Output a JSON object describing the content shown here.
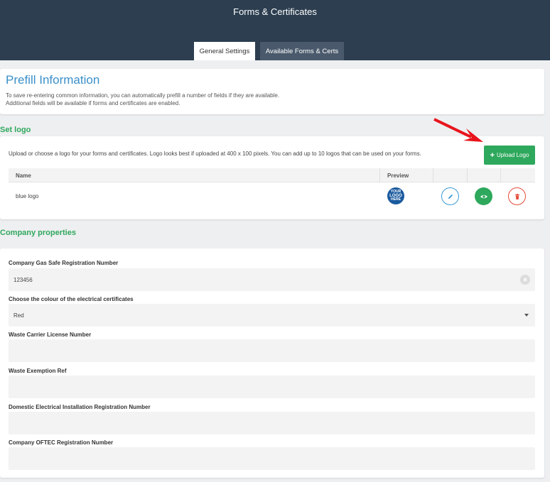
{
  "header": {
    "title": "Forms & Certificates",
    "tabs": [
      {
        "label": "General Settings",
        "active": true
      },
      {
        "label": "Available Forms & Certs",
        "active": false
      }
    ]
  },
  "prefill": {
    "title": "Prefill Information",
    "desc_line1": "To save re-entering common information, you can automatically prefill a number of fields if they are available.",
    "desc_line2": "Additional fields will be available if forms and certificates are enabled."
  },
  "set_logo": {
    "heading": "Set logo",
    "description": "Upload or choose a logo for your forms and certificates. Logo looks best if uploaded at 400 x 100 pixels. You can add up to 10 logos that can be used on your forms.",
    "upload_label": "Upload Logo",
    "columns": {
      "name": "Name",
      "preview": "Preview"
    },
    "rows": [
      {
        "name": "blue logo",
        "preview_text": [
          "YOUR",
          "LOGO",
          "HERE"
        ]
      }
    ]
  },
  "company": {
    "heading": "Company properties",
    "fields": [
      {
        "label": "Company Gas Safe Registration Number",
        "value": "123456",
        "type": "text-clearable"
      },
      {
        "label": "Choose the colour of the electrical certificates",
        "value": "Red",
        "type": "select"
      },
      {
        "label": "Waste Carrier License Number",
        "value": "",
        "type": "text"
      },
      {
        "label": "Waste Exemption Ref",
        "value": "",
        "type": "text"
      },
      {
        "label": "Domestic Electrical Installation Registration Number",
        "value": "",
        "type": "text"
      },
      {
        "label": "Company OFTEC Registration Number",
        "value": "",
        "type": "text"
      }
    ]
  },
  "colors": {
    "header_bg": "#2c3e50",
    "accent_green": "#2ea85c",
    "title_blue": "#3a8fc9",
    "delete_red": "#e74c3c",
    "annotation_arrow": "#e8141c"
  },
  "icons": [
    "plus-icon",
    "pencil-icon",
    "eye-icon",
    "trash-icon",
    "clear-icon",
    "caret-down-icon",
    "annotation-arrow"
  ]
}
